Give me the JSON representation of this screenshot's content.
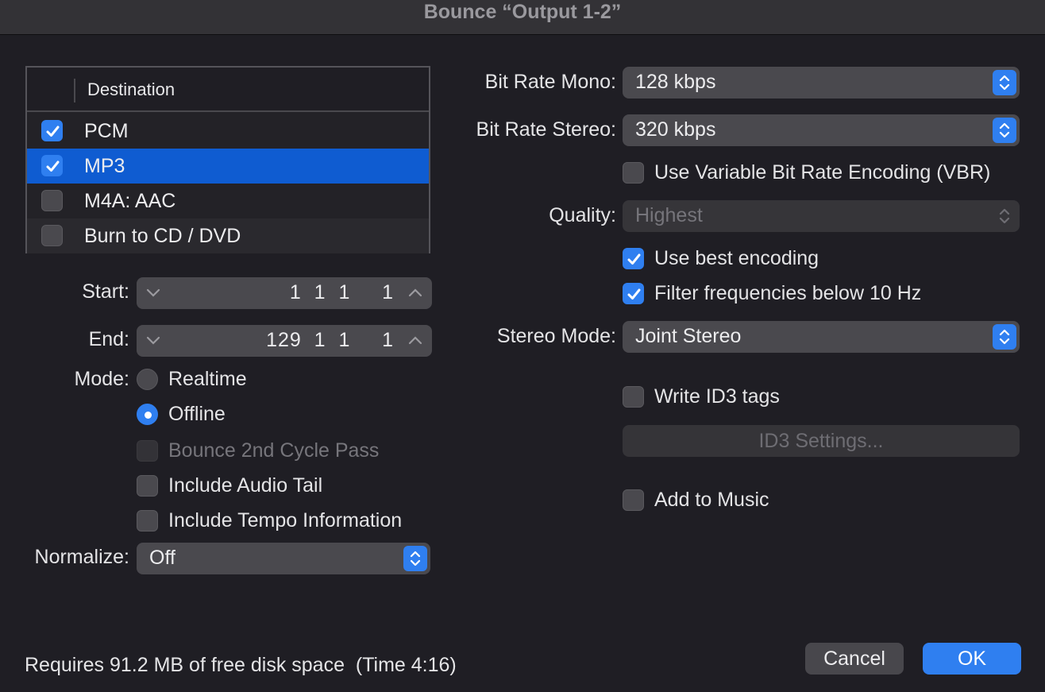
{
  "window": {
    "title": "Bounce “Output 1-2”"
  },
  "destination": {
    "header": "Destination",
    "rows": [
      {
        "label": "PCM",
        "checked": true
      },
      {
        "label": "MP3",
        "checked": true
      },
      {
        "label": "M4A: AAC",
        "checked": false
      },
      {
        "label": "Burn to CD / DVD",
        "checked": false
      }
    ]
  },
  "range": {
    "start_label": "Start:",
    "start_value": "1  1  1     1",
    "end_label": "End:",
    "end_value": "129  1  1     1"
  },
  "mode": {
    "label": "Mode:",
    "options": [
      {
        "label": "Realtime",
        "selected": false
      },
      {
        "label": "Offline",
        "selected": true
      }
    ]
  },
  "options": {
    "bounce_2nd_cycle": {
      "label": "Bounce 2nd Cycle Pass",
      "checked": false,
      "enabled": false
    },
    "include_audio_tail": {
      "label": "Include Audio Tail",
      "checked": false
    },
    "include_tempo": {
      "label": "Include Tempo Information",
      "checked": false
    }
  },
  "normalize": {
    "label": "Normalize:",
    "value": "Off"
  },
  "mp3": {
    "bit_rate_mono_label": "Bit Rate Mono:",
    "bit_rate_mono": "128 kbps",
    "bit_rate_stereo_label": "Bit Rate Stereo:",
    "bit_rate_stereo": "320 kbps",
    "vbr_label": "Use Variable Bit Rate Encoding (VBR)",
    "vbr_checked": false,
    "quality_label": "Quality:",
    "quality": "Highest",
    "best_encoding_label": "Use best encoding",
    "best_encoding_checked": true,
    "filter_label": "Filter frequencies below 10 Hz",
    "filter_checked": true,
    "stereo_mode_label": "Stereo Mode:",
    "stereo_mode": "Joint Stereo",
    "id3_label": "Write ID3 tags",
    "id3_checked": false,
    "id3_settings_button": "ID3 Settings...",
    "add_to_music_label": "Add to Music",
    "add_to_music_checked": false
  },
  "footer": {
    "status": "Requires 91.2 MB of free disk space  (Time 4:16)",
    "cancel": "Cancel",
    "ok": "OK"
  },
  "colors": {
    "accent": "#2f7ff0",
    "selection": "#0f5cd1",
    "background": "#1f1e24"
  }
}
